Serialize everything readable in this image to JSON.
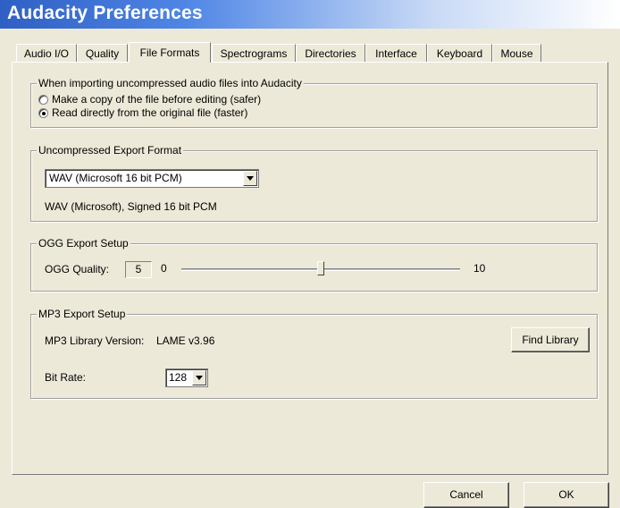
{
  "window": {
    "title": "Audacity Preferences"
  },
  "tabs": [
    {
      "label": "Audio I/O"
    },
    {
      "label": "Quality"
    },
    {
      "label": "File Formats"
    },
    {
      "label": "Spectrograms"
    },
    {
      "label": "Directories"
    },
    {
      "label": "Interface"
    },
    {
      "label": "Keyboard"
    },
    {
      "label": "Mouse"
    }
  ],
  "active_tab": "File Formats",
  "import_group": {
    "legend": "When importing uncompressed audio files into Audacity",
    "options": [
      {
        "label": "Make a copy of the file before editing (safer)",
        "selected": false
      },
      {
        "label": "Read directly from the original file (faster)",
        "selected": true
      }
    ]
  },
  "export_format": {
    "legend": "Uncompressed Export Format",
    "selected": "WAV (Microsoft 16 bit PCM)",
    "description": "WAV (Microsoft), Signed 16 bit PCM"
  },
  "ogg": {
    "legend": "OGG Export Setup",
    "quality_label": "OGG Quality:",
    "quality_value": "5",
    "min_label": "0",
    "max_label": "10",
    "slider_level": 0.5
  },
  "mp3": {
    "legend": "MP3 Export Setup",
    "version_label": "MP3 Library Version:",
    "version_value": "LAME v3.96",
    "find_library_label": "Find Library",
    "bitrate_label": "Bit Rate:",
    "bitrate_value": "128"
  },
  "buttons": {
    "cancel": "Cancel",
    "ok": "OK"
  },
  "colors": {
    "title_bar": "#2f5fc4",
    "dialog_background": "#ece9d8"
  }
}
